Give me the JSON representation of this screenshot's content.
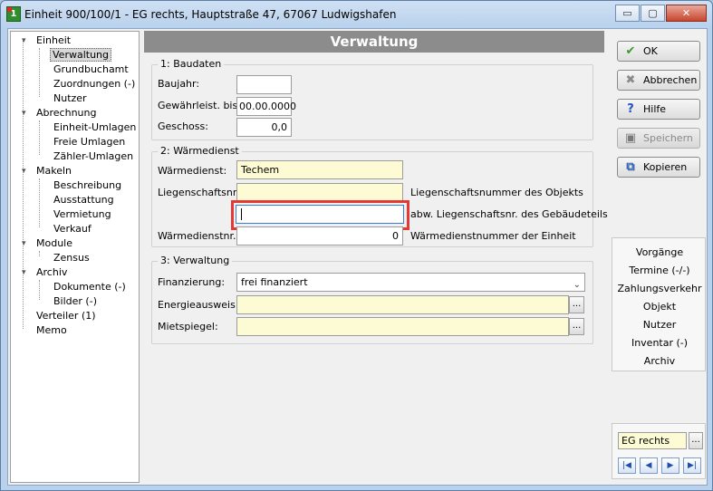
{
  "window": {
    "title": "Einheit 900/100/1 - EG rechts, Hauptstraße 47, 67067 Ludwigshafen",
    "app_icon_text": "1",
    "minimize_glyph": "▭",
    "maximize_glyph": "▢",
    "close_glyph": "✕"
  },
  "tree": {
    "expand_glyph": "▾",
    "items": [
      {
        "label": "Einheit"
      },
      {
        "label": "Verwaltung"
      },
      {
        "label": "Grundbuchamt"
      },
      {
        "label": "Zuordnungen (-)"
      },
      {
        "label": "Nutzer"
      },
      {
        "label": "Abrechnung"
      },
      {
        "label": "Einheit-Umlagen"
      },
      {
        "label": "Freie Umlagen"
      },
      {
        "label": "Zähler-Umlagen"
      },
      {
        "label": "Makeln"
      },
      {
        "label": "Beschreibung"
      },
      {
        "label": "Ausstattung"
      },
      {
        "label": "Vermietung"
      },
      {
        "label": "Verkauf"
      },
      {
        "label": "Module"
      },
      {
        "label": "Zensus"
      },
      {
        "label": "Archiv"
      },
      {
        "label": "Dokumente (-)"
      },
      {
        "label": "Bilder (-)"
      },
      {
        "label": "Verteiler (1)"
      },
      {
        "label": "Memo"
      }
    ]
  },
  "main": {
    "header": "Verwaltung",
    "baudaten": {
      "legend": "1: Baudaten",
      "baujahr_label": "Baujahr:",
      "baujahr_value": "",
      "gewaehrleist_label": "Gewährleist. bis:",
      "gewaehrleist_value": "00.00.0000",
      "geschoss_label": "Geschoss:",
      "geschoss_value": "0,0"
    },
    "waermedienst": {
      "legend": "2: Wärmedienst",
      "waermedienst_label": "Wärmedienst:",
      "waermedienst_value": "Techem",
      "liegenschaftsnr_label": "Liegenschaftsnr.:",
      "liegenschaftsnr_value": "",
      "liegenschaftsnr_hint": "Liegenschaftsnummer des Objekts",
      "abw_value": "",
      "abw_hint": "abw. Liegenschaftsnr. des Gebäudeteils",
      "waermediensttnr_label": "Wärmedienstnr.:",
      "waermediensttnr_value": "0",
      "waermediensttnr_hint": "Wärmedienstnummer der Einheit"
    },
    "verwaltung": {
      "legend": "3: Verwaltung",
      "finanzierung_label": "Finanzierung:",
      "finanzierung_value": "frei finanziert",
      "energieausweis_label": "Energieausweis:",
      "energieausweis_value": "",
      "mietspiegel_label": "Mietspiegel:",
      "mietspiegel_value": "",
      "dots": "...",
      "combo_glyph": "⌄"
    }
  },
  "actions": {
    "ok": {
      "label": "OK",
      "icon": "check-icon",
      "glyph": "✔",
      "color": "#3a9a2a"
    },
    "abbrechen": {
      "label": "Abbrechen",
      "icon": "cross-icon",
      "glyph": "✖",
      "color": "#8a8a8a"
    },
    "hilfe": {
      "label": "Hilfe",
      "icon": "question-icon",
      "glyph": "?",
      "color": "#1f55c4"
    },
    "speichern": {
      "label": "Speichern",
      "icon": "save-icon",
      "glyph": "▣",
      "color": "#7a7a7a"
    },
    "kopieren": {
      "label": "Kopieren",
      "icon": "copy-icon",
      "glyph": "⧉",
      "color": "#2a5fb0"
    }
  },
  "links": [
    "Vorgänge",
    "Termine (-/-)",
    "Zahlungsverkehr",
    "Objekt",
    "Nutzer",
    "Inventar (-)",
    "Archiv"
  ],
  "navigator": {
    "value": "EG rechts",
    "dots": "...",
    "first": "|◀",
    "prev": "◀",
    "next": "▶",
    "last": "▶|"
  }
}
